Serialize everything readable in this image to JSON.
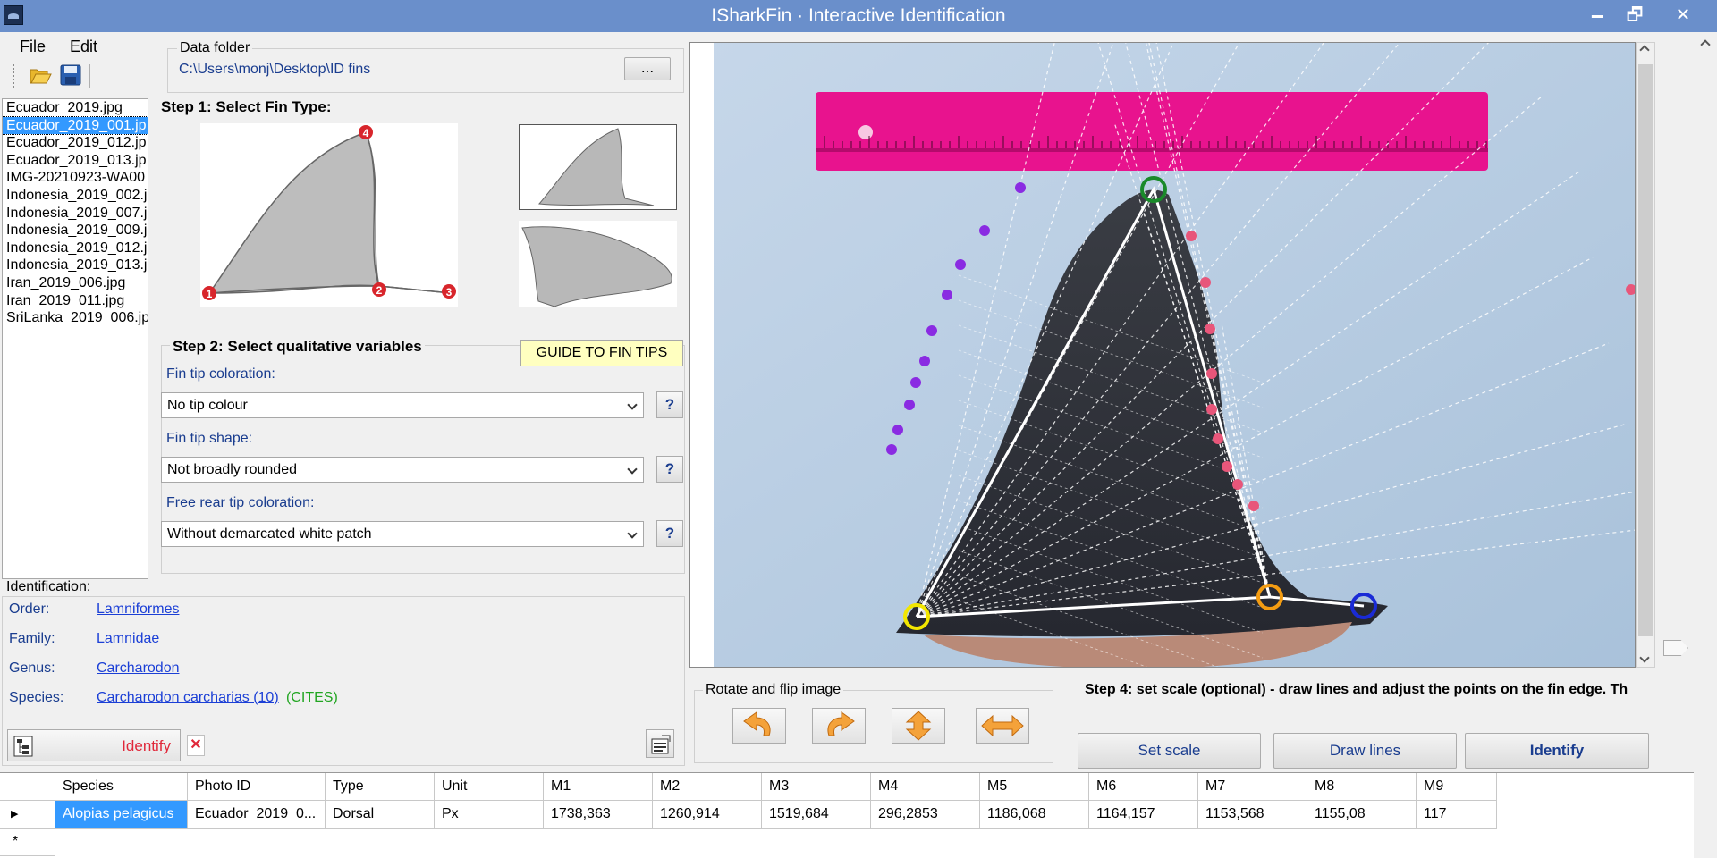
{
  "window": {
    "title": "ISharkFin · Interactive Identification",
    "minimize_glyph": "🗕",
    "restore_glyph": "🗗",
    "close_glyph": "✕"
  },
  "menu": {
    "file": "File",
    "edit": "Edit"
  },
  "toolbar": {
    "open_icon": "folder-open-icon",
    "save_icon": "save-icon"
  },
  "files": [
    "Ecuador_2019.jpg",
    "Ecuador_2019_001.jp",
    "Ecuador_2019_012.jp",
    "Ecuador_2019_013.jp",
    "IMG-20210923-WA00",
    "Indonesia_2019_002.j",
    "Indonesia_2019_007.j",
    "Indonesia_2019_009.j",
    "Indonesia_2019_012.j",
    "Indonesia_2019_013.j",
    "Iran_2019_006.jpg",
    "Iran_2019_011.jpg",
    "SriLanka_2019_006.jp"
  ],
  "selected_file_index": 1,
  "data_folder": {
    "label": "Data folder",
    "path": "C:\\Users\\monj\\Desktop\\ID fins",
    "browse_label": "..."
  },
  "step1": {
    "title": "Step 1: Select Fin Type:",
    "point_labels": [
      "1",
      "2",
      "3",
      "4"
    ]
  },
  "step2": {
    "title": "Step 2: Select qualitative variables",
    "guide_label": "GUIDE TO FIN TIPS",
    "help_label": "?",
    "fields": [
      {
        "label": "Fin tip coloration:",
        "value": "No tip colour"
      },
      {
        "label": "Fin tip shape:",
        "value": "Not broadly rounded"
      },
      {
        "label": "Free rear tip coloration:",
        "value": "Without demarcated white patch"
      }
    ]
  },
  "identification": {
    "label": "Identification:",
    "order_label": "Order:",
    "order": "Lamniformes",
    "family_label": "Family:",
    "family": "Lamnidae",
    "genus_label": "Genus:",
    "genus": "Carcharodon",
    "species_label": "Species:",
    "species": "Carcharodon carcharias (10)",
    "cites": "(CITES)",
    "identify_label": "Identify",
    "close_label": "✕"
  },
  "rotate": {
    "label": "Rotate and flip image",
    "buttons": [
      "rotate-left-icon",
      "rotate-right-icon",
      "flip-vertical-icon",
      "flip-horizontal-icon"
    ]
  },
  "step4": {
    "text": "Step 4: set scale (optional) - draw lines and adjust the points on the fin edge. Th"
  },
  "actions": {
    "set_scale": "Set scale",
    "draw_lines": "Draw lines",
    "identify": "Identify"
  },
  "table": {
    "columns": [
      "Species",
      "Photo ID",
      "Type",
      "Unit",
      "M1",
      "M2",
      "M3",
      "M4",
      "M5",
      "M6",
      "M7",
      "M8",
      "M9"
    ],
    "rows": [
      [
        "Alopias pelagicus",
        "Ecuador_2019_0...",
        "Dorsal",
        "Px",
        "1738,363",
        "1260,914",
        "1519,684",
        "296,2853",
        "1186,068",
        "1164,157",
        "1153,568",
        "1155,08",
        "117"
      ]
    ],
    "new_row_marker": "*",
    "current_row_marker": "▶"
  },
  "colors": {
    "titlebar": "#6a8fcb",
    "selection": "#3399ff",
    "ruler": "#e8138e",
    "link": "#1b3fd6",
    "cites": "#21a521",
    "alert": "#e0283a",
    "guide_bg": "#ffffc0",
    "landmark_1": "#f2e600",
    "landmark_2": "#f39c12",
    "landmark_3": "#1a2bd6",
    "landmark_4": "#1a8a2a"
  }
}
